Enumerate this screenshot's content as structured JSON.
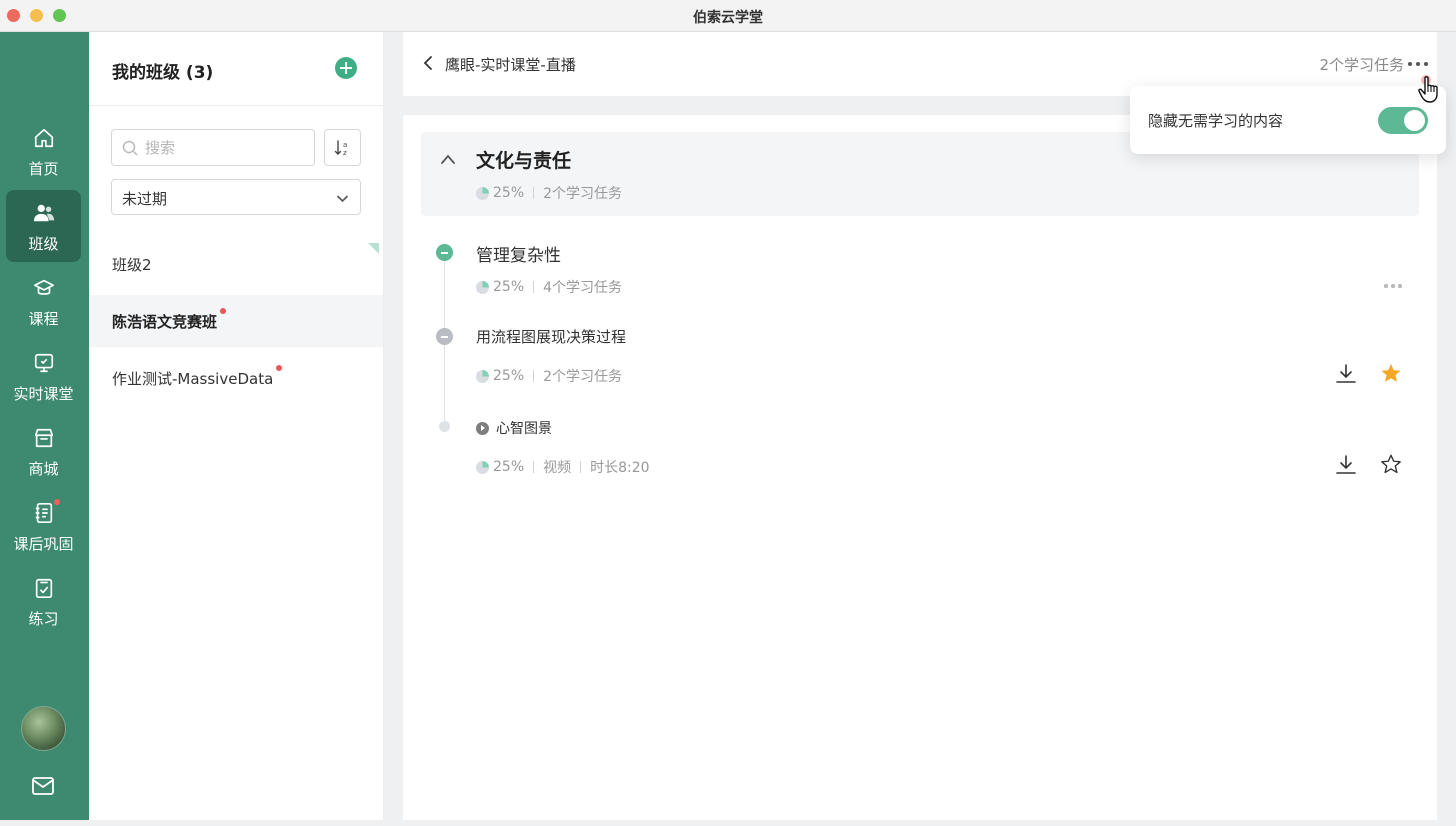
{
  "window": {
    "title": "伯索云学堂"
  },
  "nav": {
    "items": [
      {
        "label": "首页",
        "icon": "home-icon"
      },
      {
        "label": "班级",
        "icon": "class-icon",
        "active": true
      },
      {
        "label": "课程",
        "icon": "course-icon"
      },
      {
        "label": "实时课堂",
        "icon": "live-class-icon"
      },
      {
        "label": "商城",
        "icon": "store-icon"
      },
      {
        "label": "课后巩固",
        "icon": "homework-icon",
        "badge": true
      },
      {
        "label": "练习",
        "icon": "practice-icon"
      }
    ],
    "bottom": {
      "avatar": "avatar",
      "mail": "mail-icon"
    }
  },
  "classes": {
    "title": "我的班级 (3)",
    "search_placeholder": "搜索",
    "filter_value": "未过期",
    "items": [
      {
        "name": "班级2",
        "unread": false
      },
      {
        "name": "陈浩语文竞赛班",
        "unread": true,
        "active": true
      },
      {
        "name": "作业测试-MassiveData",
        "unread": true
      }
    ]
  },
  "header": {
    "breadcrumb": "鹰眼-实时课堂-直播",
    "task_count": "2个学习任务"
  },
  "popover": {
    "label": "隐藏无需学习的内容",
    "toggle_on": true
  },
  "chapter": {
    "title": "文化与责任",
    "progress": "25%",
    "progress_fraction": 0.25,
    "tasks": "2个学习任务",
    "sections": [
      {
        "title": "管理复杂性",
        "progress": "25%",
        "tasks": "4个学习任务",
        "children": [
          {
            "title": "用流程图展现决策过程",
            "progress": "25%",
            "tasks": "2个学习任务",
            "starred": true
          },
          {
            "title": "心智图景",
            "progress": "25%",
            "type": "视频",
            "duration": "时长8:20",
            "starred": false
          }
        ]
      }
    ]
  },
  "colors": {
    "rail": "#3d8a70",
    "rail_active": "#2c6753",
    "accent": "#3fae86",
    "star": "#f5a623",
    "badge": "#ee5757"
  }
}
